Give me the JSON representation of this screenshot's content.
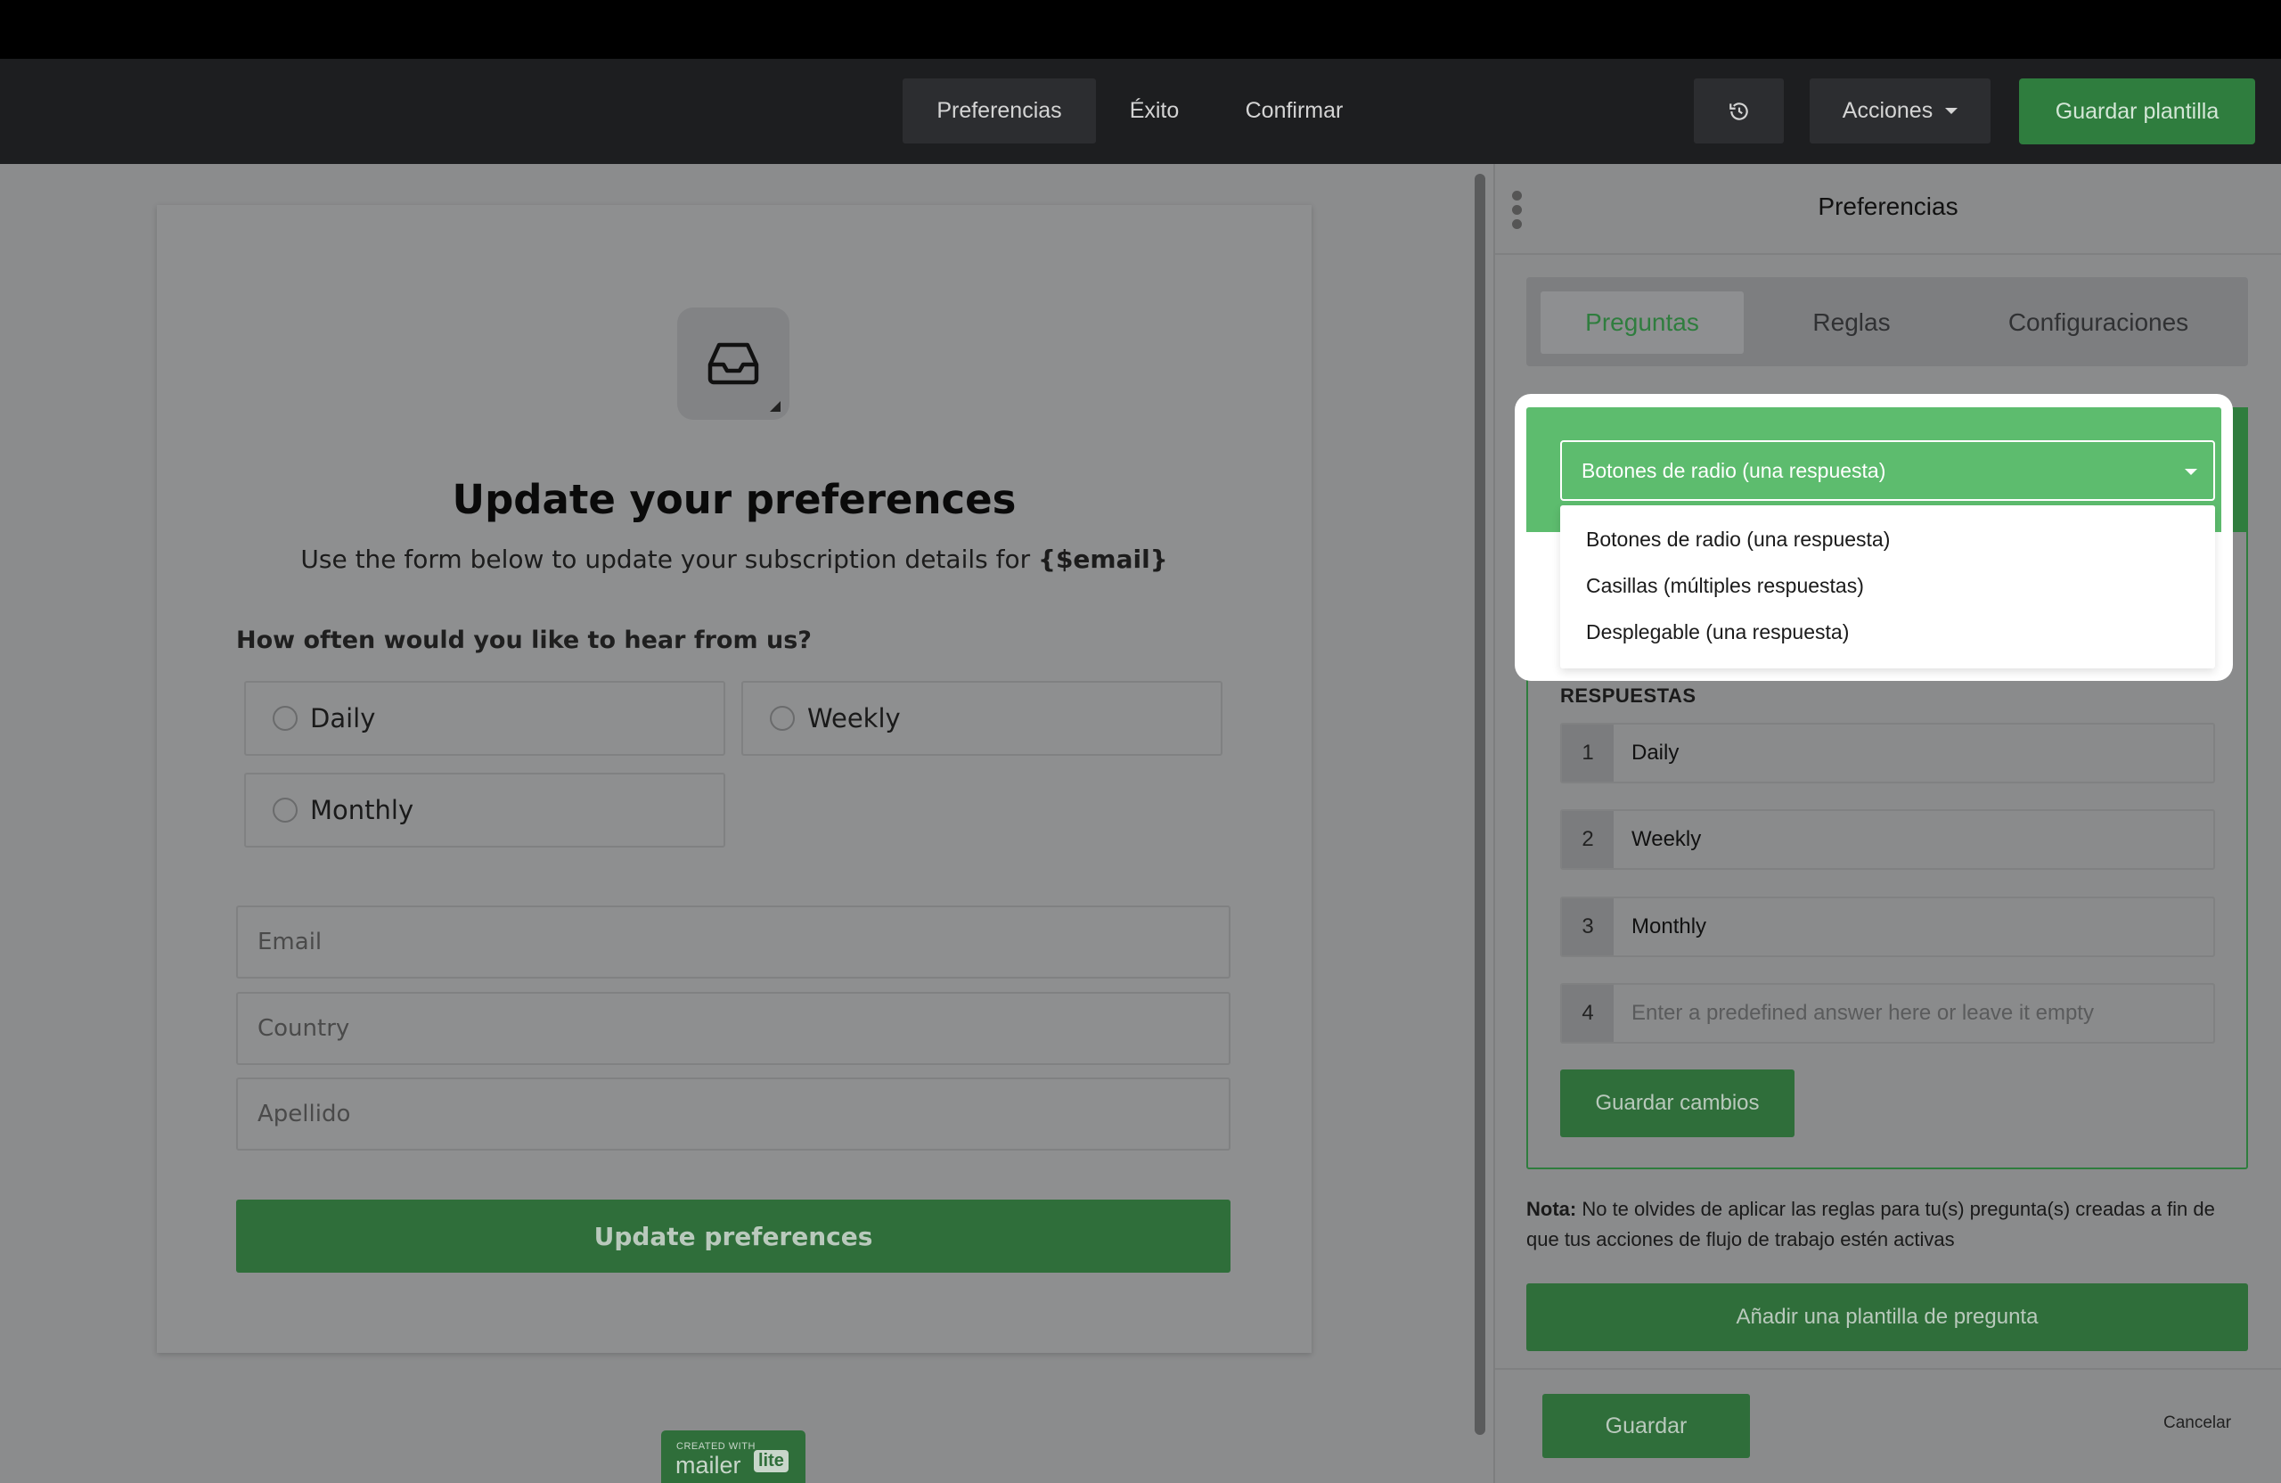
{
  "navbar": {
    "tabs": [
      "Preferencias",
      "Éxito",
      "Confirmar"
    ],
    "history_icon": "history-icon",
    "actions_label": "Acciones",
    "save_template_label": "Guardar plantilla"
  },
  "preview": {
    "icon": "inbox-icon",
    "title": "Update your preferences",
    "subtitle_prefix": "Use the form below to update your subscription details for ",
    "subtitle_bold": "{$email}",
    "question": "How often would you like to hear from us?",
    "options": [
      "Daily",
      "Weekly",
      "Monthly"
    ],
    "fields": [
      "Email",
      "Country",
      "Apellido"
    ],
    "submit_label": "Update preferences",
    "badge_small": "CREATED WITH",
    "badge_brand": "mailer",
    "badge_lite": "lite"
  },
  "panel": {
    "title": "Preferencias",
    "tabs": [
      "Preguntas",
      "Reglas",
      "Configuraciones"
    ],
    "active_tab": "Preguntas",
    "select_value": "Botones de radio (una respuesta)",
    "select_options": [
      "Botones de radio (una respuesta)",
      "Casillas (múltiples respuestas)",
      "Desplegable (una respuesta)"
    ],
    "answers_label": "RESPUESTAS",
    "answers": [
      {
        "num": "1",
        "text": "Daily"
      },
      {
        "num": "2",
        "text": "Weekly"
      },
      {
        "num": "3",
        "text": "Monthly"
      },
      {
        "num": "4",
        "placeholder": "Enter a predefined answer here or leave it empty"
      }
    ],
    "save_changes_label": "Guardar cambios",
    "note_bold": "Nota:",
    "note_text": " No te olvides de aplicar las reglas para tu(s) pregunta(s) creadas a fin de que tus acciones de flujo de trabajo estén activas",
    "add_template_label": "Añadir una plantilla de pregunta",
    "save_label": "Guardar",
    "cancel_label": "Cancelar"
  },
  "colors": {
    "accent": "#5dbc6e",
    "button_green": "#2f7d3e"
  }
}
